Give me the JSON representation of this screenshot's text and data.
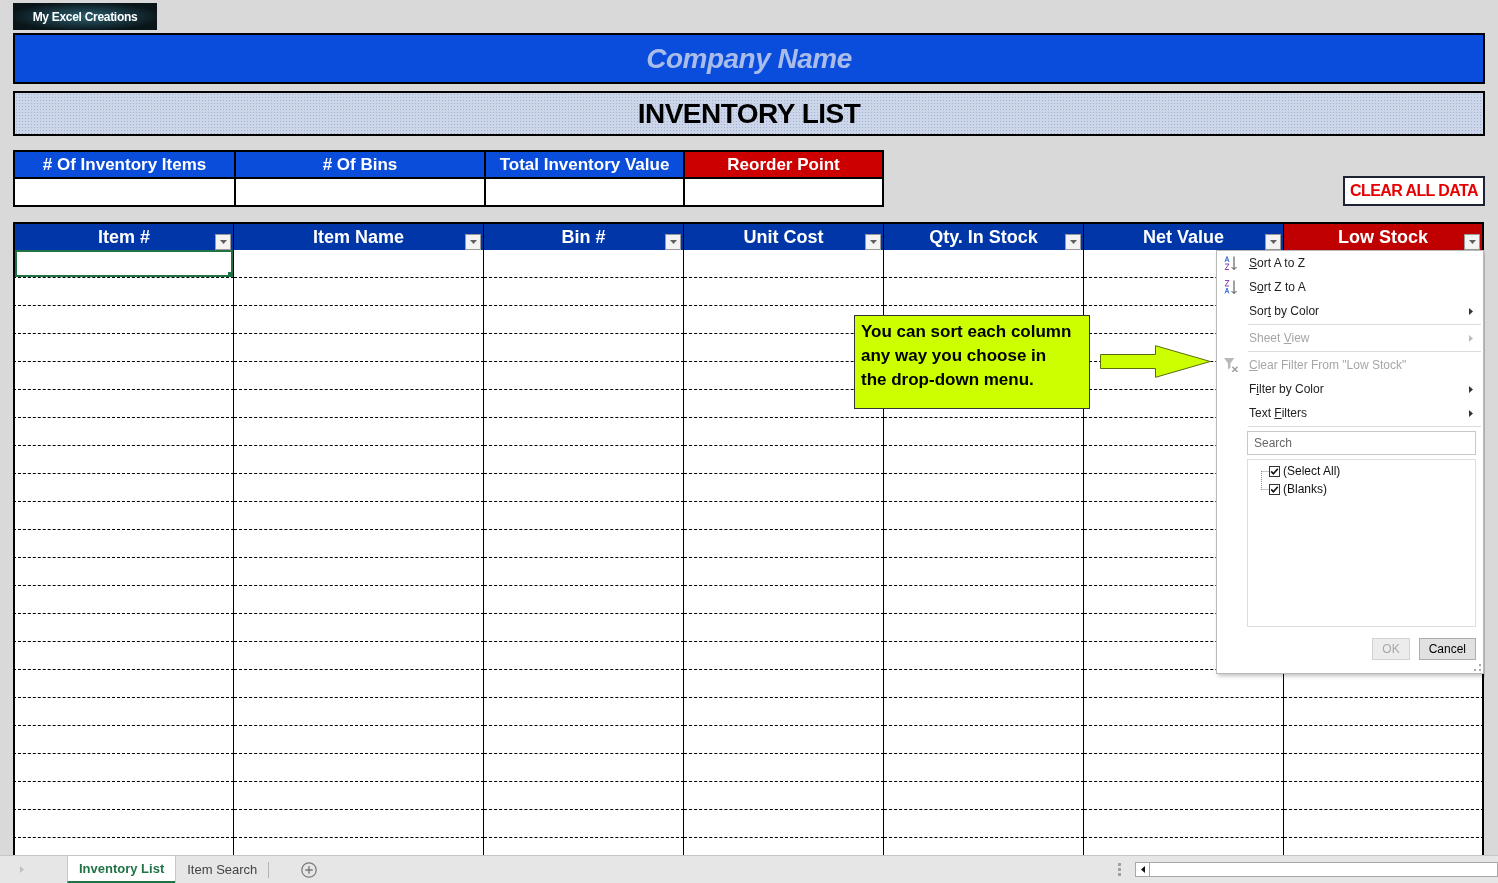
{
  "logo": {
    "text": "My Excel Creations"
  },
  "company_banner": {
    "text": "Company Name"
  },
  "title_banner": {
    "text": "INVENTORY LIST"
  },
  "summary": {
    "columns": [
      {
        "label": "# Of Inventory Items",
        "color": "#0b4ddb"
      },
      {
        "label": "# Of Bins",
        "color": "#0b4ddb"
      },
      {
        "label": "Total Inventory Value",
        "color": "#0b4ddb"
      },
      {
        "label": "Reorder Point",
        "color": "#cc0000"
      }
    ]
  },
  "clear_button": {
    "label": "CLEAR ALL DATA"
  },
  "table": {
    "columns": [
      {
        "label": "Item #",
        "color": "#0136a8"
      },
      {
        "label": "Item Name",
        "color": "#0136a8"
      },
      {
        "label": "Bin #",
        "color": "#0136a8"
      },
      {
        "label": "Unit Cost",
        "color": "#0136a8"
      },
      {
        "label": "Qty. In Stock",
        "color": "#0136a8"
      },
      {
        "label": "Net Value",
        "color": "#0136a8"
      },
      {
        "label": "Low Stock",
        "color": "#c00000"
      }
    ],
    "rows": [
      {
        "selected": true
      },
      {
        "selected": false
      },
      {
        "selected": false
      },
      {
        "selected": false
      },
      {
        "selected": false
      },
      {
        "selected": false
      },
      {
        "selected": false
      },
      {
        "selected": false
      },
      {
        "selected": false
      },
      {
        "selected": false
      },
      {
        "selected": false
      },
      {
        "selected": false
      },
      {
        "selected": false
      },
      {
        "selected": false
      },
      {
        "selected": false
      },
      {
        "selected": false
      },
      {
        "selected": false
      },
      {
        "selected": false
      },
      {
        "selected": false
      },
      {
        "selected": false
      },
      {
        "selected": false
      },
      {
        "selected": false
      }
    ]
  },
  "callout": {
    "lines": [
      "You can sort each column",
      "any way you choose in",
      "the drop-down menu."
    ]
  },
  "filter_menu": {
    "groups": [
      [
        {
          "kind": "ascending",
          "key": "S",
          "post": "ort A to Z",
          "submenu": false,
          "disabled": false
        },
        {
          "kind": "descending",
          "pre": "S",
          "key": "o",
          "post": "rt Z to A",
          "submenu": false,
          "disabled": false
        },
        {
          "kind": "plain",
          "pre": "Sor",
          "key": "t",
          "post": " by Color",
          "submenu": true,
          "disabled": false
        }
      ],
      [
        {
          "kind": "plain",
          "pre": "Sheet ",
          "key": "V",
          "post": "iew",
          "submenu": true,
          "disabled": true
        }
      ],
      [
        {
          "kind": "unfilter",
          "key": "C",
          "post": "lear Filter From \"Low Stock\"",
          "submenu": false,
          "disabled": true
        },
        {
          "kind": "plain",
          "pre": "F",
          "key": "i",
          "post": "lter by Color",
          "submenu": true,
          "disabled": false
        },
        {
          "kind": "plain",
          "pre": "Text ",
          "key": "F",
          "post": "ilters",
          "submenu": true,
          "disabled": false
        }
      ]
    ],
    "search": {
      "placeholder": "Search"
    },
    "values": [
      {
        "label": "(Select All)",
        "checked": true
      },
      {
        "label": "(Blanks)",
        "checked": true
      }
    ],
    "buttons": [
      {
        "label": "OK",
        "disabled": true
      },
      {
        "label": "Cancel",
        "disabled": false
      }
    ]
  },
  "sheet_tabs": [
    {
      "label": "Inventory List",
      "selected": true
    },
    {
      "label": "Item Search",
      "selected": false
    }
  ]
}
